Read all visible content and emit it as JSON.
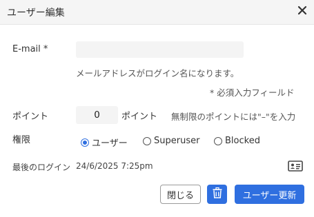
{
  "dialog": {
    "title": "ユーザー編集"
  },
  "email": {
    "label": "E-mail *",
    "value": "",
    "placeholder": "",
    "help": "メールアドレスがログイン名になります。"
  },
  "required_note": "* 必須入力フィールド",
  "points": {
    "label": "ポイント",
    "value": "0",
    "unit": "ポイント",
    "help": "無制限のポイントには\"–\"を入力"
  },
  "role": {
    "label": "権限",
    "options": [
      {
        "label": "ユーザー",
        "checked": true
      },
      {
        "label": "Superuser",
        "checked": false
      },
      {
        "label": "Blocked",
        "checked": false
      }
    ]
  },
  "last_login": {
    "label": "最後のログイン",
    "value": "24/6/2025 7:25pm"
  },
  "buttons": {
    "close": "閉じる",
    "update": "ユーザー更新"
  },
  "icons": {
    "close": "close-icon",
    "card": "id-card-icon",
    "delete": "trash-icon"
  },
  "colors": {
    "accent": "#2f6fe0",
    "header_bg": "#f5f5f5",
    "input_bg": "#f4f4f4"
  }
}
